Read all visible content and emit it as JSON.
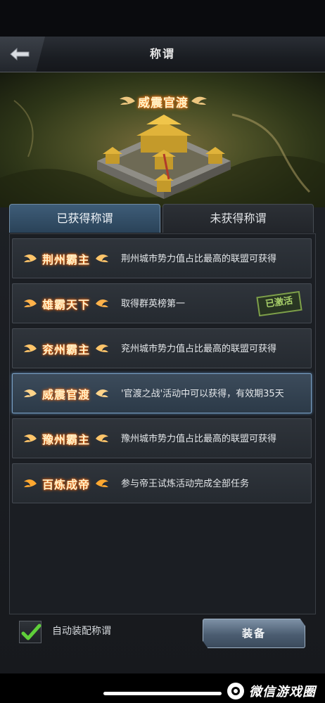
{
  "header": {
    "title": "称谓"
  },
  "hero": {
    "banner_title": "威震官渡"
  },
  "tabs": [
    {
      "label": "已获得称谓",
      "active": true
    },
    {
      "label": "未获得称谓",
      "active": false
    }
  ],
  "titles": [
    {
      "name": "荆州霸主",
      "description": "荆州城市势力值占比最高的联盟可获得",
      "stamp": "",
      "selected": false
    },
    {
      "name": "雄霸天下",
      "description": "取得群英榜第一",
      "stamp": "已激活",
      "selected": false
    },
    {
      "name": "兖州霸主",
      "description": "兖州城市势力值占比最高的联盟可获得",
      "stamp": "",
      "selected": false
    },
    {
      "name": "威震官渡",
      "description": "'官渡之战'活动中可以获得，有效期35天",
      "stamp": "",
      "selected": true
    },
    {
      "name": "豫州霸主",
      "description": "豫州城市势力值占比最高的联盟可获得",
      "stamp": "",
      "selected": false
    },
    {
      "name": "百炼成帝",
      "description": "参与帝王试炼活动完成全部任务",
      "stamp": "",
      "selected": false
    }
  ],
  "footer": {
    "auto_equip_label": "自动装配称谓",
    "auto_equip_checked": true,
    "equip_button": "装备"
  },
  "watermark": {
    "text": "微信游戏圈"
  },
  "colors": {
    "accent": "#3e5d78",
    "badge_glow": "#ff7a10",
    "check": "#5fcf3a"
  }
}
